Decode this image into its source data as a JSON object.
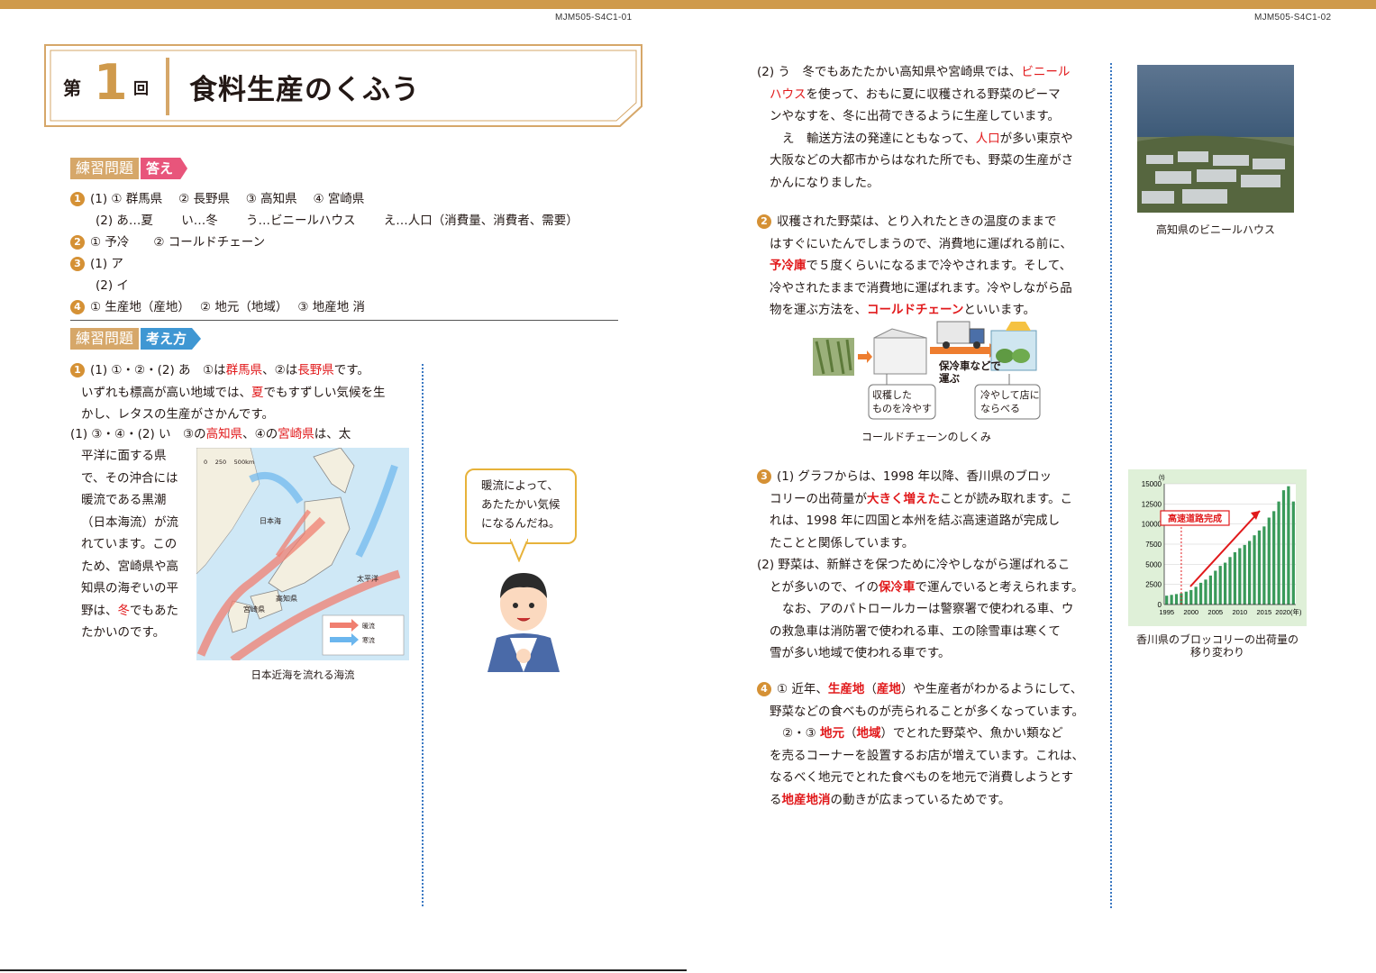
{
  "header": {
    "code_left": "MJM505-S4C1-01",
    "code_right": "MJM505-S4C1-02",
    "title_prefix": "第",
    "title_number": "1",
    "title_suffix": "回",
    "title": "食料生産のくふう"
  },
  "colors": {
    "accent": "#cf9a4c",
    "answer_tag": "#e8557b",
    "thinking_tag": "#3f97d3",
    "emphasis_red": "#e1191b",
    "number_badge": "#d59135",
    "divider_blue": "#3a78c2"
  },
  "answers": {
    "heading": "練習問題",
    "tag": "答え",
    "n1": "1",
    "n2": "2",
    "n3": "3",
    "n4": "4",
    "line1": "(1) ① 群馬県　 ② 長野県　 ③ 高知県　 ④ 宮崎県",
    "line2_a": "(2) あ…夏",
    "line2_b": "い…冬",
    "line2_c": "う…ビニールハウス",
    "line2_d": "え…人口（消費量、消費者、需要）",
    "line3": "① 予冷　　② コールドチェーン",
    "line4": "(1) ア",
    "line5": "(2) イ",
    "line6": "① 生産地（産地）　 ② 地元（地域）　 ③ 地産地 消"
  },
  "thinking": {
    "heading": "練習問題",
    "tag": "考え方",
    "q1_p1_l1_a": "(1) ①・②・(2) あ　①は",
    "q1_p1_l1_r1": "群馬県",
    "q1_p1_l1_b": "、②は",
    "q1_p1_l1_r2": "長野県",
    "q1_p1_l1_c": "です。",
    "q1_p1_l2_a": "いずれも標高が高い地域では、",
    "q1_p1_l2_r": "夏",
    "q1_p1_l2_b": "でもすずしい気候を生",
    "q1_p1_l3": "かし、レタスの生産がさかんです。",
    "q1_p2_l1_a": "(1) ③・④・(2) い　③の",
    "q1_p2_l1_r1": "高知県",
    "q1_p2_l1_b": "、④の",
    "q1_p2_l1_r2": "宮崎県",
    "q1_p2_l1_c": "は、太",
    "q1_p2_lines": [
      "平洋に面する県",
      "で、その沖合には",
      "暖流である黒潮",
      "（日本海流）が流",
      "れています。この",
      "ため、宮崎県や高",
      "知県の海ぞいの平"
    ],
    "q1_p2_last_a": "野は、",
    "q1_p2_last_r": "冬",
    "q1_p2_last_b": "でもあた",
    "q1_p2_end": "たかいのです。",
    "map_caption": "日本近海を流れる海流",
    "map_labels": {
      "sea_japan": "日本海",
      "pacific": "太平洋",
      "kochi": "高知県",
      "miyazaki": "宮崎県",
      "scale": "0　 250　 500km",
      "warm": "暖流",
      "cold": "寒流"
    },
    "speech": [
      "暖流によって、",
      "あたたかい気候",
      "になるんだね。"
    ]
  },
  "right": {
    "q1_2u_a": "(2) う　冬でもあたたかい高知県や宮崎県では、",
    "q1_2u_r1": "ビニール",
    "q1_2u_r2": "ハウス",
    "q1_2u_b": "を使って、おもに夏に収穫される野菜のピーマ",
    "q1_2u_c": "ンやなすを、冬に出荷できるように生産しています。",
    "q1_2e_a": "え　輸送方法の発達にともなって、",
    "q1_2e_r": "人口",
    "q1_2e_b": "が多い東京や",
    "q1_2e_c": "大阪などの大都市からはなれた所でも、野菜の生産がさ",
    "q1_2e_d": "かんになりました。",
    "photo_caption": "高知県のビニールハウス",
    "q2_l1": "収穫された野菜は、とり入れたときの温度のままで",
    "q2_l2": "はすぐにいたんでしまうので、消費地に運ばれる前に、",
    "q2_l3_r": "予冷庫",
    "q2_l3_b": "で５度くらいになるまで冷やされます。そして、",
    "q2_l4": "冷やされたままで消費地に運ばれます。冷やしながら品",
    "q2_l5_a": "物を運ぶ方法を、",
    "q2_l5_r": "コールドチェーン",
    "q2_l5_b": "といいます。",
    "cold_labels": {
      "box1": [
        "収穫した",
        "ものを冷やす"
      ],
      "box2": [
        "冷やして店に",
        "ならべる"
      ],
      "truck": [
        "保冷車などで",
        "運ぶ"
      ]
    },
    "cold_caption": "コールドチェーンのしくみ",
    "q3_l1": "(1) グラフからは、1998 年以降、香川県のブロッ",
    "q3_l2_a": "コリーの出荷量が",
    "q3_l2_r": "大きく増えた",
    "q3_l2_b": "ことが読み取れます。こ",
    "q3_l3": "れは、1998 年に四国と本州を結ぶ高速道路が完成し",
    "q3_l4": "たことと関係しています。",
    "q3_l5": "(2) 野菜は、新鮮さを保つために冷やしながら運ばれるこ",
    "q3_l6_a": "とが多いので、イの",
    "q3_l6_r": "保冷車",
    "q3_l6_b": "で運んでいると考えられます。",
    "q3_l7": "なお、アのパトロールカーは警察署で使われる車、ウ",
    "q3_l8": "の救急車は消防署で使われる車、エの除雪車は寒くて",
    "q3_l9": "雪が多い地域で使われる車です。",
    "chart_caption_1": "香川県のブロッコリーの出荷量の",
    "chart_caption_2": "移り変わり",
    "q4_l1_a": "① 近年、",
    "q4_l1_r1": "生産地",
    "q4_l1_b": "（",
    "q4_l1_r2": "産地",
    "q4_l1_c": "）や生産者がわかるようにして、",
    "q4_l2": "野菜などの食べものが売られることが多くなっています。",
    "q4_l3_a": "②・③ ",
    "q4_l3_r1": "地元",
    "q4_l3_b": "（",
    "q4_l3_r2": "地域",
    "q4_l3_c": "）でとれた野菜や、魚かい類など",
    "q4_l4": "を売るコーナーを設置するお店が増えています。これは、",
    "q4_l5": "なるべく地元でとれた食べものを地元で消費しようとす",
    "q4_l6_a": "る",
    "q4_l6_r": "地産地消",
    "q4_l6_b": "の動きが広まっているためです。"
  },
  "chart_data": {
    "type": "bar",
    "unit": "(t)",
    "categories": [
      1995,
      1996,
      1997,
      1998,
      1999,
      2000,
      2001,
      2002,
      2003,
      2004,
      2005,
      2006,
      2007,
      2008,
      2009,
      2010,
      2011,
      2012,
      2013,
      2014,
      2015,
      2016,
      2017,
      2018,
      2019,
      2020,
      2021
    ],
    "values": [
      1100,
      1200,
      1300,
      1400,
      1600,
      1800,
      2200,
      2700,
      3100,
      3600,
      4200,
      4800,
      5200,
      5900,
      6500,
      7000,
      7400,
      7900,
      8600,
      9200,
      9700,
      10800,
      11600,
      12800,
      14200,
      14700,
      12800
    ],
    "xticks": [
      "1995",
      "2000",
      "2005",
      "2010",
      "2015",
      "2020(年)"
    ],
    "yticks": [
      "0",
      "2500",
      "5000",
      "7500",
      "10000",
      "12500",
      "15000"
    ],
    "ylim": [
      0,
      15000
    ],
    "annotation": "高速道路完成",
    "bar_color": "#3a9a5a",
    "bg_color": "#dff0d8"
  }
}
